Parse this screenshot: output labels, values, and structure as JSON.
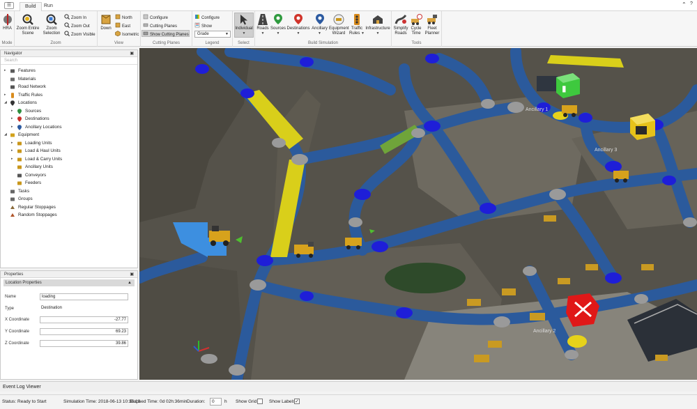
{
  "app": {
    "tabs": [
      {
        "label": "Build"
      },
      {
        "label": "Run"
      }
    ]
  },
  "ribbon": {
    "groups": {
      "mode": "Mode",
      "zoom": "Zoom",
      "view": "View",
      "cutting_planes": "Cutting Planes",
      "legend": "Legend",
      "select": "Select",
      "build_simulation": "Build Simulation",
      "tools": "Tools"
    },
    "hra": "HRA",
    "zoom_entire_scene": [
      "Zoom Entire",
      "Scene"
    ],
    "zoom_selection": [
      "Zoom",
      "Selection"
    ],
    "zoom_in": "Zoom In",
    "zoom_out": "Zoom Out",
    "zoom_visible": "Zoom Visible",
    "down": "Down",
    "north": "North",
    "east": "East",
    "isometric": "Isometric",
    "configure_cp": "Configure",
    "cutting_planes_btn": "Cutting Planes",
    "show_cutting_planes": "Show Cutting Planes",
    "configure_legend": "Configure",
    "show_legend": "Show",
    "legend_select": "Grade",
    "individual": "Individual",
    "roads": "Roads",
    "sources": "Sources",
    "destinations": "Destinations",
    "ancillary": "Ancillary",
    "equipment_wizard": [
      "Equipment",
      "Wizard"
    ],
    "traffic_rules": [
      "Traffic",
      "Rules"
    ],
    "infrastructure": "Infrastructure",
    "simplify_roads": [
      "Simplify",
      "Roads"
    ],
    "cycle_time": [
      "Cycle",
      "Time"
    ],
    "fleet_planner": [
      "Fleet",
      "Planner"
    ]
  },
  "navigator": {
    "title": "Navigator",
    "search_placeholder": "Search",
    "items": [
      {
        "label": "Features",
        "icon": "features-icon",
        "depth": 0,
        "expander": true,
        "color": "#5a5a5a"
      },
      {
        "label": "Materials",
        "icon": "materials-icon",
        "depth": 0,
        "expander": false,
        "color": "#6b6b6b"
      },
      {
        "label": "Road Network",
        "icon": "road-network-icon",
        "depth": 0,
        "expander": false,
        "color": "#555"
      },
      {
        "label": "Traffic Rules",
        "icon": "traffic-rules-icon",
        "depth": 0,
        "expander": true,
        "color": "#d98b1c"
      },
      {
        "label": "Locations",
        "icon": "location-pin-icon",
        "depth": 0,
        "expander": true,
        "expanded": true,
        "color": "#333"
      },
      {
        "label": "Sources",
        "icon": "source-pin-icon",
        "depth": 1,
        "expander": true,
        "color": "#2f8f3f"
      },
      {
        "label": "Destinations",
        "icon": "destination-pin-icon",
        "depth": 1,
        "expander": true,
        "color": "#c8302a"
      },
      {
        "label": "Ancillary Locations",
        "icon": "ancillary-pin-icon",
        "depth": 1,
        "expander": true,
        "color": "#2c5aa0"
      },
      {
        "label": "Equipment",
        "icon": "equipment-icon",
        "depth": 0,
        "expander": true,
        "expanded": true,
        "color": "#d2a21c"
      },
      {
        "label": "Loading Units",
        "icon": "loader-icon",
        "depth": 1,
        "expander": true,
        "color": "#c9961a"
      },
      {
        "label": "Load & Haul Units",
        "icon": "load-haul-icon",
        "depth": 1,
        "expander": true,
        "color": "#c9961a"
      },
      {
        "label": "Load & Carry Units",
        "icon": "load-carry-icon",
        "depth": 1,
        "expander": true,
        "color": "#c9961a"
      },
      {
        "label": "Ancillary Units",
        "icon": "ancillary-unit-icon",
        "depth": 1,
        "expander": false,
        "color": "#c9961a"
      },
      {
        "label": "Conveyors",
        "icon": "conveyor-icon",
        "depth": 1,
        "expander": false,
        "color": "#555"
      },
      {
        "label": "Feeders",
        "icon": "feeder-icon",
        "depth": 1,
        "expander": false,
        "color": "#c9961a"
      },
      {
        "label": "Tasks",
        "icon": "tasks-icon",
        "depth": 0,
        "expander": false,
        "color": "#666"
      },
      {
        "label": "Groups",
        "icon": "groups-icon",
        "depth": 0,
        "expander": false,
        "color": "#666"
      },
      {
        "label": "Regular Stoppages",
        "icon": "regular-stoppages-icon",
        "depth": 0,
        "expander": false,
        "color": "#8a6a3a"
      },
      {
        "label": "Random Stoppages",
        "icon": "random-stoppages-icon",
        "depth": 0,
        "expander": false,
        "color": "#b0552a"
      }
    ]
  },
  "properties": {
    "title": "Properties",
    "section": "Location Properties",
    "fields": {
      "name_label": "Name",
      "name_value": "loading",
      "type_label": "Type",
      "type_value": "Destination",
      "x_label": "X Coordinate",
      "x_value": "-27.77",
      "y_label": "Y Coordinate",
      "y_value": "69.23",
      "z_label": "Z Coordinate",
      "z_value": "39.86"
    }
  },
  "viewport": {
    "labels": {
      "ancillary_1": "Ancillary 1",
      "ancillary_2": "Ancillary 2",
      "ancillary_3": "Ancillary 3"
    },
    "colors": {
      "road": "#2b5a9c",
      "node_blue": "#1e1ed8",
      "node_grey": "#9a9a9a",
      "segment_yellow": "#d9cf1a",
      "segment_green": "#6fa43a",
      "loading_area": "#3d8fe0",
      "ancillary_green": "#3ec93e",
      "ancillary_yellow": "#e6c21a",
      "ancillary_red": "#e01818"
    }
  },
  "event_log": {
    "title": "Event Log Viewer"
  },
  "status": {
    "status_text": "Status: Ready to Start",
    "sim_time": "Simulation Time: 2018-06-13 10:36:19",
    "elapsed_time": "Elapsed Time: 0d 02h:36min",
    "duration_label": "Duration:",
    "duration_value": "0",
    "duration_unit": "h",
    "show_grid_label": "Show Grid",
    "show_grid_checked": false,
    "show_labels_label": "Show Labels",
    "show_labels_checked": true
  }
}
